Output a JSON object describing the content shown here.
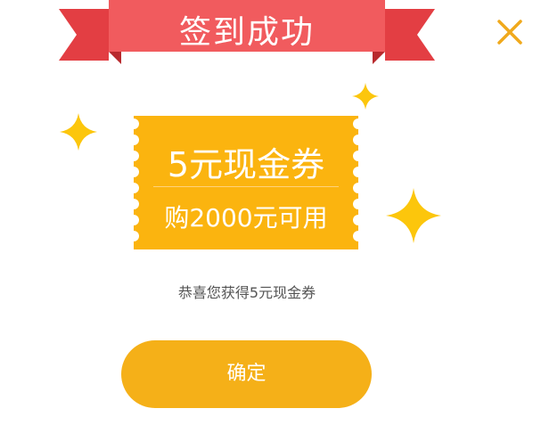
{
  "dialog": {
    "title": "签到成功",
    "coupon": {
      "amount_label": "5元现金券",
      "condition_label": "购2000元可用"
    },
    "message": "恭喜您获得5元现金券",
    "confirm_label": "确定"
  },
  "icons": {
    "close": "close-icon",
    "sparkle": "sparkle-icon"
  },
  "colors": {
    "ribbon_main": "#f15b5e",
    "ribbon_tail": "#e33e43",
    "ribbon_fold": "#b8292d",
    "coupon": "#fbb40f",
    "button": "#f5b018",
    "sparkle": "#fcc60c",
    "close": "#f0a91c"
  }
}
